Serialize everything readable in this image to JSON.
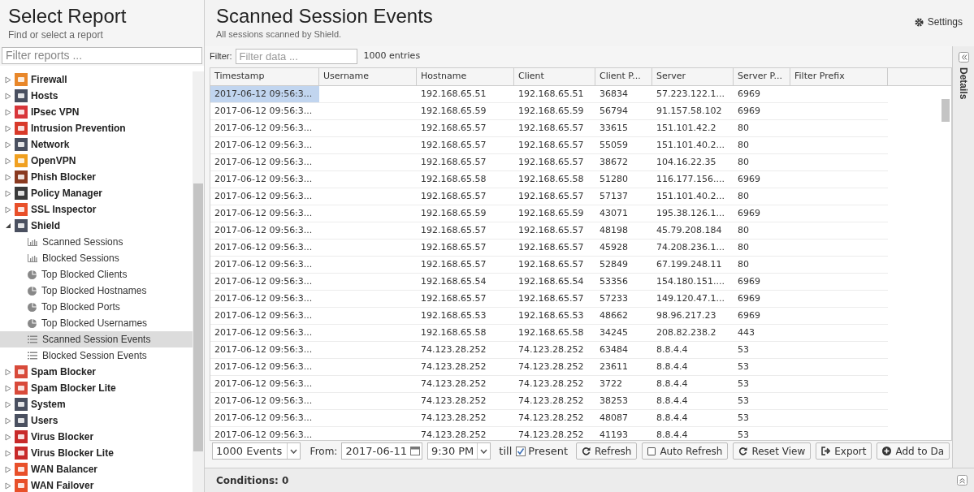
{
  "sidebar": {
    "title": "Select Report",
    "subtitle": "Find or select a report",
    "filter_placeholder": "Filter reports ...",
    "tree": [
      {
        "label": "Firewall",
        "color": "#e8872a",
        "expanded": false,
        "selected": false
      },
      {
        "label": "Hosts",
        "color": "#4a5060",
        "expanded": false,
        "selected": false
      },
      {
        "label": "IPsec VPN",
        "color": "#d8363a",
        "expanded": false,
        "selected": false
      },
      {
        "label": "Intrusion Prevention",
        "color": "#d83a2a",
        "expanded": false,
        "selected": false
      },
      {
        "label": "Network",
        "color": "#4a5060",
        "expanded": false,
        "selected": false
      },
      {
        "label": "OpenVPN",
        "color": "#f0a020",
        "expanded": false,
        "selected": false
      },
      {
        "label": "Phish Blocker",
        "color": "#8a3a20",
        "expanded": false,
        "selected": false
      },
      {
        "label": "Policy Manager",
        "color": "#3a3a3a",
        "expanded": false,
        "selected": false
      },
      {
        "label": "SSL Inspector",
        "color": "#e8502a",
        "expanded": false,
        "selected": false
      },
      {
        "label": "Shield",
        "color": "#4a5060",
        "expanded": true,
        "selected": false,
        "children": [
          {
            "label": "Scanned Sessions",
            "kind": "bar",
            "selected": false
          },
          {
            "label": "Blocked Sessions",
            "kind": "bar",
            "selected": false
          },
          {
            "label": "Top Blocked Clients",
            "kind": "pie",
            "selected": false
          },
          {
            "label": "Top Blocked Hostnames",
            "kind": "pie",
            "selected": false
          },
          {
            "label": "Top Blocked Ports",
            "kind": "pie",
            "selected": false
          },
          {
            "label": "Top Blocked Usernames",
            "kind": "pie",
            "selected": false
          },
          {
            "label": "Scanned Session Events",
            "kind": "list",
            "selected": true
          },
          {
            "label": "Blocked Session Events",
            "kind": "list",
            "selected": false
          }
        ]
      },
      {
        "label": "Spam Blocker",
        "color": "#d84a3a",
        "expanded": false,
        "selected": false
      },
      {
        "label": "Spam Blocker Lite",
        "color": "#d84a3a",
        "expanded": false,
        "selected": false
      },
      {
        "label": "System",
        "color": "#4a5060",
        "expanded": false,
        "selected": false
      },
      {
        "label": "Users",
        "color": "#4a5060",
        "expanded": false,
        "selected": false
      },
      {
        "label": "Virus Blocker",
        "color": "#c82a2a",
        "expanded": false,
        "selected": false
      },
      {
        "label": "Virus Blocker Lite",
        "color": "#c82a2a",
        "expanded": false,
        "selected": false
      },
      {
        "label": "WAN Balancer",
        "color": "#e8502a",
        "expanded": false,
        "selected": false
      },
      {
        "label": "WAN Failover",
        "color": "#e8502a",
        "expanded": false,
        "selected": false
      }
    ]
  },
  "header": {
    "title": "Scanned Session Events",
    "subtitle": "All sessions scanned by Shield.",
    "settings": "Settings"
  },
  "filter": {
    "label": "Filter:",
    "placeholder": "Filter data ...",
    "count": "1000 entries"
  },
  "table": {
    "columns": [
      "Timestamp",
      "Username",
      "Hostname",
      "Client",
      "Client P...",
      "Server",
      "Server P...",
      "Filter Prefix"
    ],
    "rows": [
      {
        "selected": true,
        "cells": [
          "2017-06-12 09:56:3...",
          "",
          "192.168.65.51",
          "192.168.65.51",
          "36834",
          "57.223.122.1...",
          "6969",
          ""
        ]
      },
      {
        "selected": false,
        "cells": [
          "2017-06-12 09:56:3...",
          "",
          "192.168.65.59",
          "192.168.65.59",
          "56794",
          "91.157.58.102",
          "6969",
          ""
        ]
      },
      {
        "selected": false,
        "cells": [
          "2017-06-12 09:56:3...",
          "",
          "192.168.65.57",
          "192.168.65.57",
          "33615",
          "151.101.42.2",
          "80",
          ""
        ]
      },
      {
        "selected": false,
        "cells": [
          "2017-06-12 09:56:3...",
          "",
          "192.168.65.57",
          "192.168.65.57",
          "55059",
          "151.101.40.2...",
          "80",
          ""
        ]
      },
      {
        "selected": false,
        "cells": [
          "2017-06-12 09:56:3...",
          "",
          "192.168.65.57",
          "192.168.65.57",
          "38672",
          "104.16.22.35",
          "80",
          ""
        ]
      },
      {
        "selected": false,
        "cells": [
          "2017-06-12 09:56:3...",
          "",
          "192.168.65.58",
          "192.168.65.58",
          "51280",
          "116.177.156....",
          "6969",
          ""
        ]
      },
      {
        "selected": false,
        "cells": [
          "2017-06-12 09:56:3...",
          "",
          "192.168.65.57",
          "192.168.65.57",
          "57137",
          "151.101.40.2...",
          "80",
          ""
        ]
      },
      {
        "selected": false,
        "cells": [
          "2017-06-12 09:56:3...",
          "",
          "192.168.65.59",
          "192.168.65.59",
          "43071",
          "195.38.126.1...",
          "6969",
          ""
        ]
      },
      {
        "selected": false,
        "cells": [
          "2017-06-12 09:56:3...",
          "",
          "192.168.65.57",
          "192.168.65.57",
          "48198",
          "45.79.208.184",
          "80",
          ""
        ]
      },
      {
        "selected": false,
        "cells": [
          "2017-06-12 09:56:3...",
          "",
          "192.168.65.57",
          "192.168.65.57",
          "45928",
          "74.208.236.1...",
          "80",
          ""
        ]
      },
      {
        "selected": false,
        "cells": [
          "2017-06-12 09:56:3...",
          "",
          "192.168.65.57",
          "192.168.65.57",
          "52849",
          "67.199.248.11",
          "80",
          ""
        ]
      },
      {
        "selected": false,
        "cells": [
          "2017-06-12 09:56:3...",
          "",
          "192.168.65.54",
          "192.168.65.54",
          "53356",
          "154.180.151....",
          "6969",
          ""
        ]
      },
      {
        "selected": false,
        "cells": [
          "2017-06-12 09:56:3...",
          "",
          "192.168.65.57",
          "192.168.65.57",
          "57233",
          "149.120.47.1...",
          "6969",
          ""
        ]
      },
      {
        "selected": false,
        "cells": [
          "2017-06-12 09:56:3...",
          "",
          "192.168.65.53",
          "192.168.65.53",
          "48662",
          "98.96.217.23",
          "6969",
          ""
        ]
      },
      {
        "selected": false,
        "cells": [
          "2017-06-12 09:56:3...",
          "",
          "192.168.65.58",
          "192.168.65.58",
          "34245",
          "208.82.238.2",
          "443",
          ""
        ]
      },
      {
        "selected": false,
        "cells": [
          "2017-06-12 09:56:3...",
          "",
          "74.123.28.252",
          "74.123.28.252",
          "63484",
          "8.8.4.4",
          "53",
          ""
        ]
      },
      {
        "selected": false,
        "cells": [
          "2017-06-12 09:56:3...",
          "",
          "74.123.28.252",
          "74.123.28.252",
          "23611",
          "8.8.4.4",
          "53",
          ""
        ]
      },
      {
        "selected": false,
        "cells": [
          "2017-06-12 09:56:3...",
          "",
          "74.123.28.252",
          "74.123.28.252",
          "3722",
          "8.8.4.4",
          "53",
          ""
        ]
      },
      {
        "selected": false,
        "cells": [
          "2017-06-12 09:56:3...",
          "",
          "74.123.28.252",
          "74.123.28.252",
          "38253",
          "8.8.4.4",
          "53",
          ""
        ]
      },
      {
        "selected": false,
        "cells": [
          "2017-06-12 09:56:3...",
          "",
          "74.123.28.252",
          "74.123.28.252",
          "48087",
          "8.8.4.4",
          "53",
          ""
        ]
      },
      {
        "selected": false,
        "cells": [
          "2017-06-12 09:56:3...",
          "",
          "74.123.28.252",
          "74.123.28.252",
          "41193",
          "8.8.4.4",
          "53",
          ""
        ]
      }
    ]
  },
  "details_tab": "Details",
  "toolbar": {
    "limit": "1000 Events",
    "from_label": "From:",
    "date": "2017-06-11",
    "time": "9:30 PM",
    "till_label": "till",
    "present": {
      "label": "Present",
      "checked": true
    },
    "buttons": [
      {
        "label": "Refresh",
        "kind": "refresh"
      },
      {
        "label": "Auto Refresh",
        "kind": "checkbox",
        "checked": false
      },
      {
        "label": "Reset View",
        "kind": "refresh"
      },
      {
        "label": "Export",
        "kind": "export"
      },
      {
        "label": "Add to Da",
        "kind": "add"
      }
    ]
  },
  "conditions": "Conditions: 0"
}
